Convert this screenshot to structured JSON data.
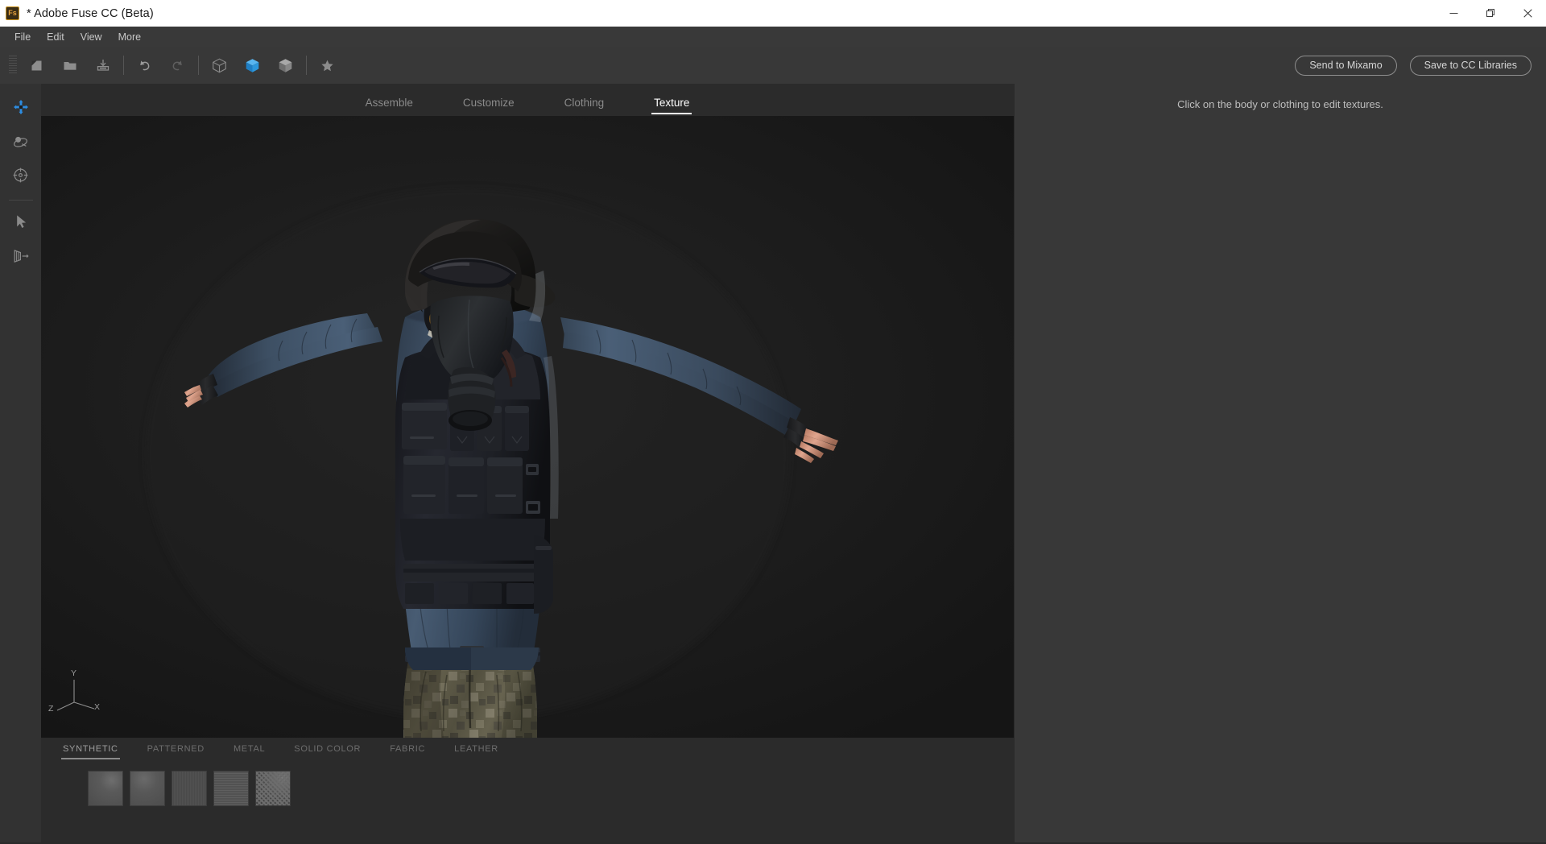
{
  "window": {
    "title": "* Adobe Fuse CC (Beta)",
    "app_icon": "fuse-app-icon",
    "app_icon_text": "Fs",
    "controls": [
      {
        "name": "minimize",
        "icon": "minimize-icon"
      },
      {
        "name": "maximize",
        "icon": "maximize-icon"
      },
      {
        "name": "close",
        "icon": "close-icon"
      }
    ],
    "titlebar_bg": "#ffffff",
    "titlebar_fg": "#1a1a1a"
  },
  "menubar": {
    "items": [
      {
        "label": "File"
      },
      {
        "label": "Edit"
      },
      {
        "label": "View"
      },
      {
        "label": "More"
      }
    ]
  },
  "toolbar": {
    "groups": [
      {
        "buttons": [
          {
            "label": "New",
            "icon": "new-file-icon",
            "active": false
          },
          {
            "label": "Open",
            "icon": "open-folder-icon",
            "active": false
          },
          {
            "label": "Save",
            "icon": "save-download-icon",
            "active": false
          }
        ]
      },
      {
        "buttons": [
          {
            "label": "Undo",
            "icon": "undo-arrow-icon",
            "active": false
          },
          {
            "label": "Redo",
            "icon": "redo-arrow-icon",
            "active": false
          }
        ]
      },
      {
        "buttons": [
          {
            "label": "Wireframe view",
            "icon": "cube-wireframe-icon",
            "active": false
          },
          {
            "label": "Shaded view",
            "icon": "cube-solid-icon",
            "active": true
          },
          {
            "label": "Textured view",
            "icon": "cube-shaded-icon",
            "active": false
          }
        ]
      },
      {
        "buttons": [
          {
            "label": "Favorites",
            "icon": "star-icon",
            "active": false
          }
        ]
      }
    ],
    "accent_color": "#2d8ce0",
    "send_to_mixamo_label": "Send to Mixamo",
    "save_to_cc_label": "Save to CC Libraries"
  },
  "main_tabs": [
    {
      "label": "Assemble",
      "active": false
    },
    {
      "label": "Customize",
      "active": false
    },
    {
      "label": "Clothing",
      "active": false
    },
    {
      "label": "Texture",
      "active": true
    }
  ],
  "tool_rail": {
    "items": [
      {
        "label": "Pan",
        "icon": "move-pan-icon",
        "active": true
      },
      {
        "label": "Orbit",
        "icon": "orbit-rotate-icon",
        "active": false
      },
      {
        "label": "Frame selection",
        "icon": "target-focus-icon",
        "active": false
      }
    ],
    "items_after_divider": [
      {
        "label": "Select",
        "icon": "cursor-arrow-icon",
        "active": false
      },
      {
        "label": "Mirror",
        "icon": "mirror-flip-icon",
        "active": false
      }
    ],
    "active_color": "#2d8ce0"
  },
  "viewport": {
    "background_color": "#1b1b1b",
    "gizmo": {
      "y_label": "Y",
      "x_label": "X",
      "z_label": "Z"
    },
    "character": {
      "description": "Male character in A-pose wearing gas mask, goggles and helmet, blue chambray shirt, black tactical vest with pouches, fingerless gloves, digital camouflage trousers",
      "skin_color": "#d9a08c",
      "shirt_color": "#3c4e63",
      "vest_color": "#23242a",
      "helmet_color": "#1d1c1b",
      "goggle_lens_color": "#8a6024",
      "camo_base_color": "#5e5a49",
      "glove_color": "#1c1c1e"
    }
  },
  "texture_panel": {
    "categories": [
      {
        "label": "SYNTHETIC",
        "active": true
      },
      {
        "label": "PATTERNED",
        "active": false
      },
      {
        "label": "METAL",
        "active": false
      },
      {
        "label": "SOLID COLOR",
        "active": false
      },
      {
        "label": "FABRIC",
        "active": false
      },
      {
        "label": "LEATHER",
        "active": false
      }
    ],
    "swatches": [
      {
        "name": "synthetic-swatch-1",
        "color": "#555555",
        "style": "smooth-sheen"
      },
      {
        "name": "synthetic-swatch-2",
        "color": "#565656",
        "style": "smooth-matte"
      },
      {
        "name": "synthetic-swatch-3",
        "color": "#4e4e4e",
        "style": "fine-weave"
      },
      {
        "name": "synthetic-swatch-4",
        "color": "#595959",
        "style": "brushed-lines"
      },
      {
        "name": "synthetic-swatch-5",
        "color": "#4a4a4a",
        "style": "carbon-diamond"
      }
    ]
  },
  "right_panel": {
    "hint": "Click on the body or clothing to edit textures.",
    "background_color": "#383838"
  }
}
